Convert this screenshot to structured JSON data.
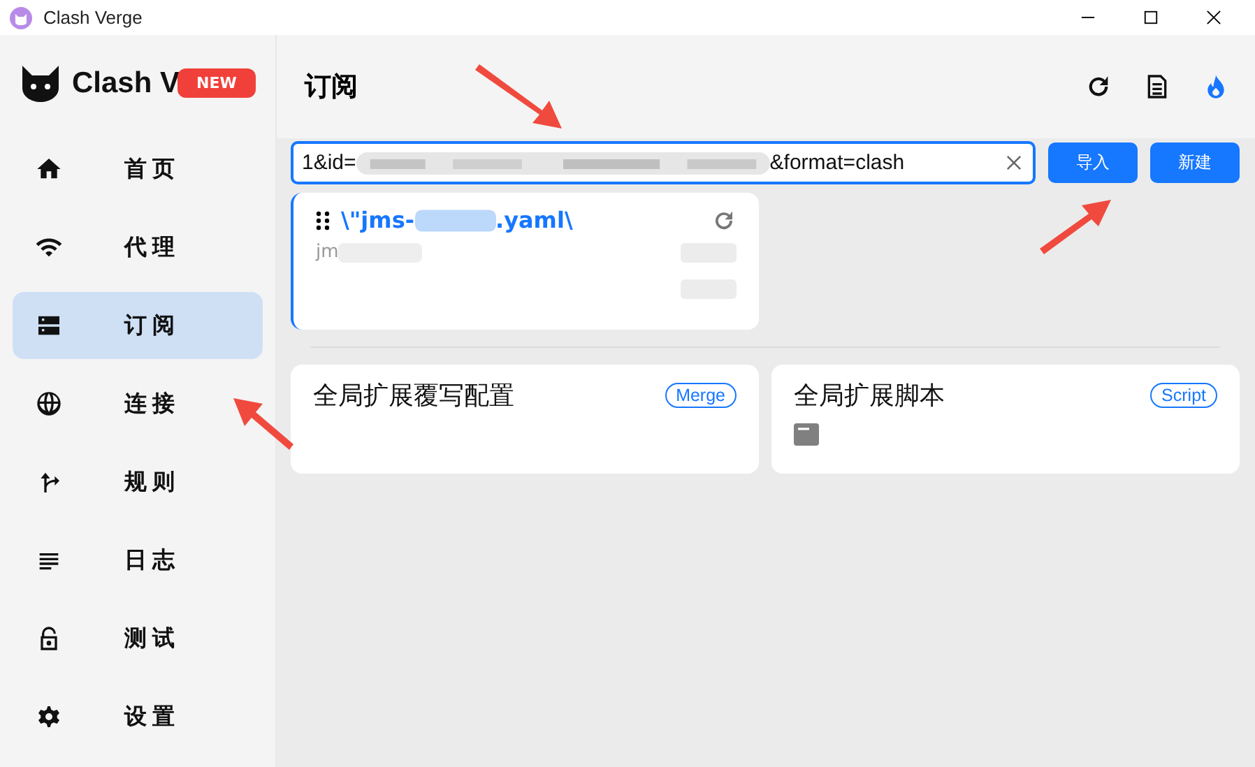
{
  "window": {
    "title": "Clash Verge"
  },
  "sidebar": {
    "logo_text": "Clash V",
    "badge": "NEW",
    "items": [
      {
        "label": "首页",
        "selected": false
      },
      {
        "label": "代理",
        "selected": false
      },
      {
        "label": "订阅",
        "selected": true
      },
      {
        "label": "连接",
        "selected": false
      },
      {
        "label": "规则",
        "selected": false
      },
      {
        "label": "日志",
        "selected": false
      },
      {
        "label": "测试",
        "selected": false
      },
      {
        "label": "设置",
        "selected": false
      }
    ]
  },
  "page": {
    "title": "订阅"
  },
  "url_field": {
    "visible_parts": [
      "1&id=",
      "&format=clash"
    ]
  },
  "buttons": [
    "导入",
    "新建"
  ],
  "profile": {
    "selected": true,
    "title_parts": [
      "\\\"jms-",
      ".yaml\\"
    ],
    "subtitle": "jm"
  },
  "global_cards": [
    {
      "title": "全局扩展覆写配置",
      "tag": "Merge",
      "has_file_icon": false
    },
    {
      "title": "全局扩展脚本",
      "tag": "Script",
      "has_file_icon": true
    }
  ]
}
